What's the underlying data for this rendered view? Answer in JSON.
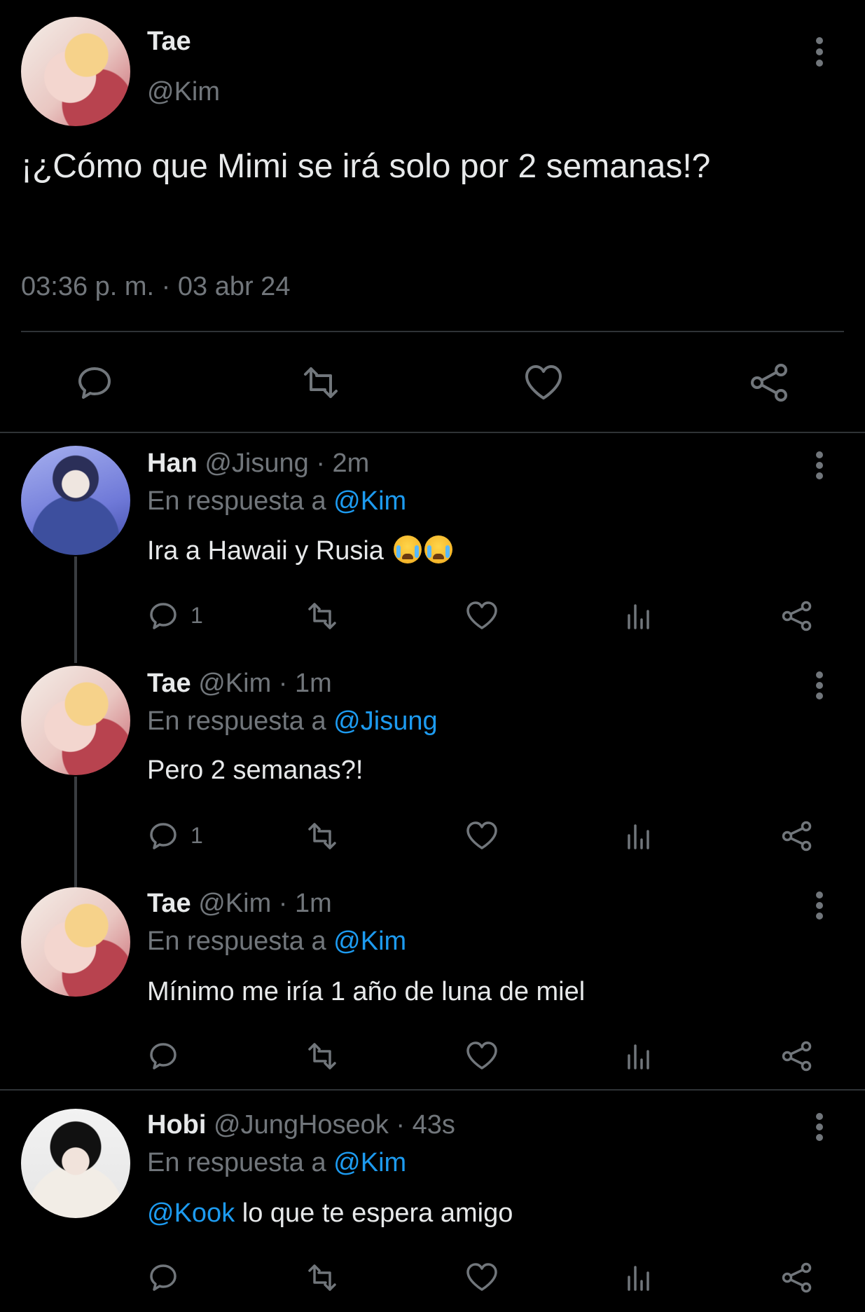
{
  "main": {
    "name": "Tae",
    "handle": "@Kim",
    "text": "¡¿Cómo que Mimi se irá solo por 2 semanas!?",
    "timestamp": "03:36 p. m. · 03 abr 24"
  },
  "replies": [
    {
      "name": "Han",
      "meta": "@Jisung · 2m",
      "reply_prefix": "En respuesta a ",
      "reply_to": "@Kim",
      "text": "Ira a Hawaii y Rusia",
      "emoji": "😭😭",
      "reply_count": "1"
    },
    {
      "name": "Tae",
      "meta": "@Kim · 1m",
      "reply_prefix": "En respuesta a ",
      "reply_to": "@Jisung",
      "text": "Pero 2 semanas?!",
      "reply_count": "1"
    },
    {
      "name": "Tae",
      "meta": "@Kim · 1m",
      "reply_prefix": "En respuesta a ",
      "reply_to": "@Kim",
      "text": "Mínimo me iría 1 año de luna de miel",
      "reply_count": ""
    },
    {
      "name": "Hobi",
      "meta": "@JungHoseok · 43s",
      "reply_prefix": "En respuesta a ",
      "reply_to": "@Kim",
      "mention": "@Kook",
      "text": " lo que te espera amigo",
      "reply_count": ""
    }
  ],
  "colors": {
    "background": "#000000",
    "text": "#e7e9ea",
    "muted": "#71767b",
    "link": "#1d9bf0",
    "divider": "#2f3336"
  },
  "icons": [
    "more-icon",
    "reply-icon",
    "retweet-icon",
    "like-icon",
    "share-icon",
    "views-icon"
  ]
}
